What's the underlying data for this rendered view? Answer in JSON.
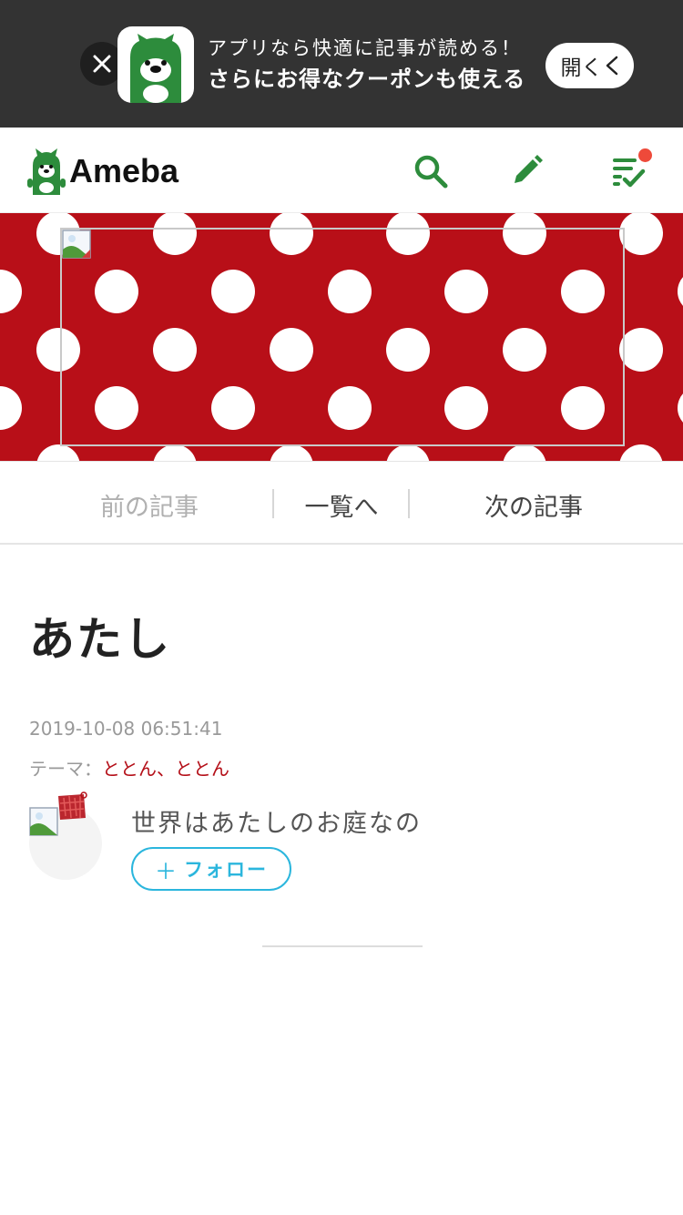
{
  "app_banner": {
    "line1": "アプリなら快適に記事が読める！",
    "line2": "さらにお得なクーポンも使える",
    "open_label": "開く"
  },
  "header": {
    "logo_text": "Ameba",
    "icons": [
      "search-icon",
      "pencil-icon",
      "checklist-icon"
    ],
    "has_notification": true
  },
  "article_nav": {
    "prev_label": "前の記事",
    "list_label": "一覧へ",
    "next_label": "次の記事"
  },
  "article": {
    "title": "あたし",
    "date": "2019-10-08 06:51:41",
    "theme_label": "テーマ：",
    "theme_value": "ととん、ととん"
  },
  "author": {
    "name": "世界はあたしのお庭なの",
    "follow_label": "フォロー",
    "follow_prefix": "＋"
  },
  "colors": {
    "banner_bg": "#333333",
    "brand_green": "#2d8c3c",
    "blog_red": "#b80f18",
    "follow_blue": "#2bb6dd",
    "notification": "#ee4a3a"
  }
}
